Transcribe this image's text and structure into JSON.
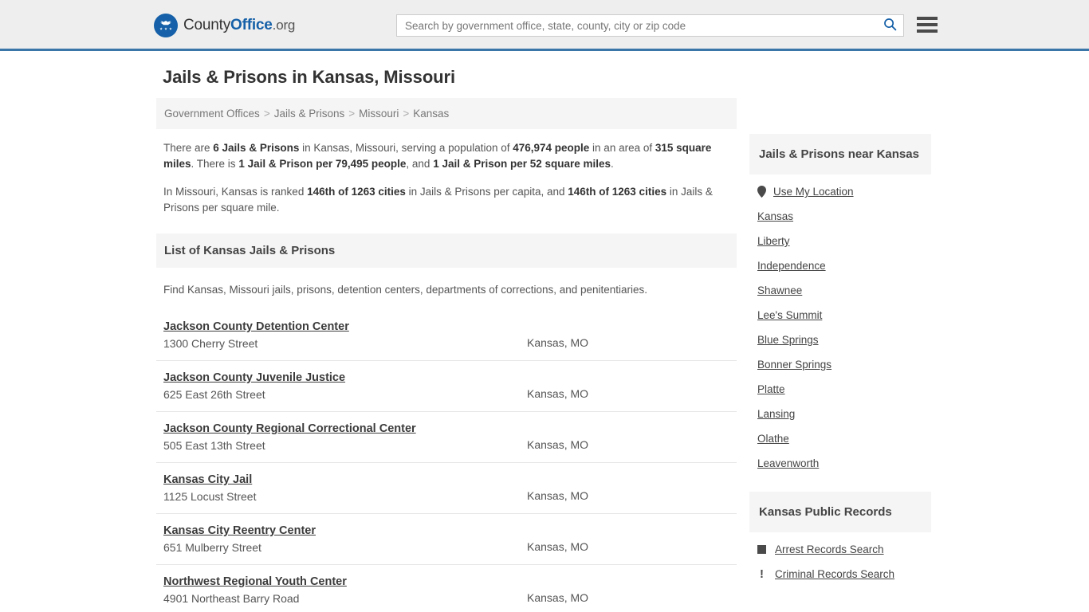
{
  "header": {
    "logo": {
      "icon": "eagle-seal-icon",
      "text_part1": "County",
      "text_part2": "Office",
      "text_part3": ".org"
    },
    "search": {
      "placeholder": "Search by government office, state, county, city or zip code",
      "value": "",
      "search_icon": "search-icon"
    },
    "menu_icon": "hamburger-menu-icon",
    "accent_color": "#3a76a8",
    "background_color": "#eeeeee"
  },
  "main": {
    "page_title": "Jails & Prisons in Kansas, Missouri",
    "breadcrumb": [
      "Government Offices",
      "Jails & Prisons",
      "Missouri",
      "Kansas"
    ],
    "breadcrumb_separator": ">",
    "stats": {
      "line1_a": "There are ",
      "line1_b": "6 Jails & Prisons",
      "line1_c": " in Kansas, Missouri, serving a population of ",
      "line1_d": "476,974 people",
      "line1_e": " in an area of ",
      "line1_f": "315 square miles",
      "line1_g": ". There is ",
      "line1_h": "1 Jail & Prison per 79,495 people",
      "line1_i": ", and ",
      "line1_j": "1 Jail & Prison per 52 square miles",
      "line1_k": ".",
      "line2_a": "In Missouri, Kansas is ranked ",
      "line2_b": "146th of 1263 cities",
      "line2_c": " in Jails & Prisons per capita, and ",
      "line2_d": "146th of 1263 cities",
      "line2_e": " in Jails & Prisons per square mile."
    },
    "list_section": {
      "heading": "List of Kansas Jails & Prisons",
      "description": "Find Kansas, Missouri jails, prisons, detention centers, departments of corrections, and penitentiaries."
    },
    "listings": [
      {
        "name": "Jackson County Detention Center",
        "address": "1300 Cherry Street",
        "locality": "Kansas, MO"
      },
      {
        "name": "Jackson County Juvenile Justice",
        "address": "625 East 26th Street",
        "locality": "Kansas, MO"
      },
      {
        "name": "Jackson County Regional Correctional Center",
        "address": "505 East 13th Street",
        "locality": "Kansas, MO"
      },
      {
        "name": "Kansas City Jail",
        "address": "1125 Locust Street",
        "locality": "Kansas, MO"
      },
      {
        "name": "Kansas City Reentry Center",
        "address": "651 Mulberry Street",
        "locality": "Kansas, MO"
      },
      {
        "name": "Northwest Regional Youth Center",
        "address": "4901 Northeast Barry Road",
        "locality": "Kansas, MO"
      }
    ]
  },
  "sidebar": {
    "nearby": {
      "heading": "Jails & Prisons near Kansas",
      "use_my_location": {
        "label": "Use My Location",
        "icon": "map-pin-icon"
      },
      "cities": [
        "Kansas",
        "Liberty",
        "Independence",
        "Shawnee",
        "Lee's Summit",
        "Blue Springs",
        "Bonner Springs",
        "Platte",
        "Lansing",
        "Olathe",
        "Leavenworth"
      ]
    },
    "public_records": {
      "heading": "Kansas Public Records",
      "items": [
        {
          "label": "Arrest Records Search",
          "icon": "square-badge-icon"
        },
        {
          "label": "Criminal Records Search",
          "icon": "exclamation-icon"
        }
      ]
    }
  }
}
